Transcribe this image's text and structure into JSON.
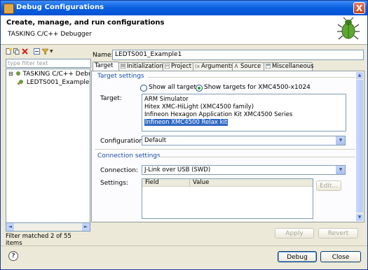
{
  "window": {
    "title": "Debug Configurations",
    "close_glyph": "X"
  },
  "header": {
    "title": "Create, manage, and run configurations",
    "subtitle": "TASKING C/C++ Debugger"
  },
  "left": {
    "filter_placeholder": "type filter text",
    "tree": [
      {
        "label": "TASKING C/C++ Debu",
        "expander": "⊟"
      },
      {
        "label": "LEDTS001_Example"
      }
    ],
    "status": "Filter matched 2 of 55 items"
  },
  "name": {
    "label": "Name:",
    "value": "LEDTS001_Example1"
  },
  "tabs": [
    {
      "label": "Target"
    },
    {
      "label": "Initialization"
    },
    {
      "label": "Project"
    },
    {
      "label": "Arguments"
    },
    {
      "label": "Source"
    },
    {
      "label": "Miscellaneous"
    }
  ],
  "target_settings": {
    "group_title": "Target settings",
    "radio_all": "Show all targets",
    "radio_filtered": "Show targets for XMC4500-x1024",
    "target_label": "Target:",
    "targets": [
      "ARM Simulator",
      "Hitex XMC-HiLight (XMC4500 family)",
      "Infineon Hexagon Application Kit XMC4500 Series",
      "Infineon XMC4500 Relax kit"
    ],
    "config_label": "Configuration:",
    "config_value": "Default"
  },
  "connection_settings": {
    "group_title": "Connection settings",
    "connection_label": "Connection:",
    "connection_value": "J-Link over USB (SWD)",
    "settings_label": "Settings:",
    "columns": [
      "Field",
      "Value"
    ],
    "edit_button": "Edit..."
  },
  "buttons": {
    "apply": "Apply",
    "revert": "Revert",
    "debug": "Debug",
    "close": "Close"
  },
  "icons": {
    "help_glyph": "?",
    "down_arrow": "▼",
    "left_arrow": "◄",
    "right_arrow": "►",
    "up_arrow": "▲"
  }
}
